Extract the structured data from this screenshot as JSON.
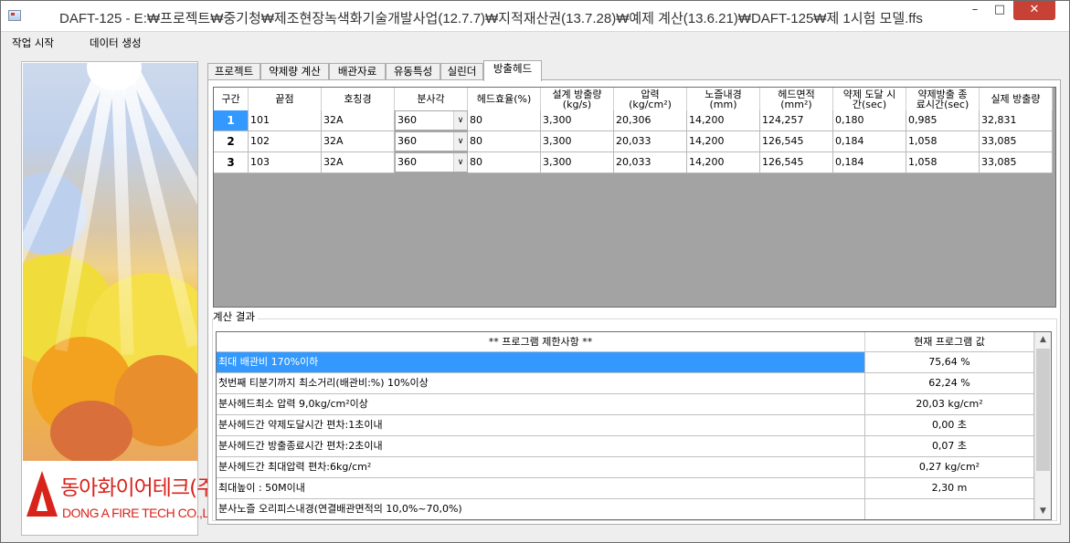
{
  "window": {
    "title": "DAFT-125 - E:₩프로젝트₩중기청₩제조현장녹색화기술개발사업(12.7.7)₩지적재산권(13.7.28)₩예제 계산(13.6.21)₩DAFT-125₩제 1시험 모델.ffs",
    "min": "–",
    "max": "□",
    "close": "✕"
  },
  "menu": {
    "start": "작업 시작",
    "generate": "데이터 생성"
  },
  "logo": {
    "kr": "동아화이어테크(주)",
    "en": "DONG A FIRE TECH CO.,LTD."
  },
  "tabs": [
    "프로젝트",
    "약제량 계산",
    "배관자료",
    "유동특성",
    "실린더",
    "방출헤드"
  ],
  "active_tab": 5,
  "grid": {
    "headers": [
      "구간",
      "끝점",
      "호칭경",
      "분사각",
      "헤드효율(%)",
      "설계 방출량\n(kg/s)",
      "압력\n(kg/cm²)",
      "노즐내경\n(mm)",
      "헤드면적\n(mm²)",
      "약제 도달 시\n간(sec)",
      "약제방출 종\n료시간(sec)",
      "실제 방출량"
    ],
    "rows": [
      [
        "1",
        "101",
        "32A",
        "360",
        "80",
        "3,300",
        "20,306",
        "14,200",
        "124,257",
        "0,180",
        "0,985",
        "32,831"
      ],
      [
        "2",
        "102",
        "32A",
        "360",
        "80",
        "3,300",
        "20,033",
        "14,200",
        "126,545",
        "0,184",
        "1,058",
        "33,085"
      ],
      [
        "3",
        "103",
        "32A",
        "360",
        "80",
        "3,300",
        "20,033",
        "14,200",
        "126,545",
        "0,184",
        "1,058",
        "33,085"
      ]
    ],
    "selected_row": 0
  },
  "result": {
    "label": "계산 결과",
    "headers": [
      "** 프로그램 제한사항 **",
      "현재 프로그램 값"
    ],
    "rows": [
      [
        "최대 배관비  170%이하",
        "75,64 %"
      ],
      [
        "첫번째 티분기까지 최소거리(배관비:%) 10%이상",
        "62,24 %"
      ],
      [
        "분사헤드최소 압력 9,0kg/cm²이상",
        "20,03 kg/cm²"
      ],
      [
        "분사헤드간 약제도달시간 편차:1초이내",
        "0,00 초"
      ],
      [
        "분사헤드간 방출종료시간 편차:2초이내",
        "0,07 초"
      ],
      [
        "분사헤드간 최대압력 편차:6kg/cm²",
        "0,27 kg/cm²"
      ],
      [
        "최대높이 :  50M이내",
        "2,30 m"
      ],
      [
        "분사노즐 오리피스내경(연결배관면적의 10,0%~70,0%)",
        ""
      ]
    ],
    "selected_row": 0
  },
  "icons": {
    "dropdown": "chevron-down-icon",
    "scroll_up": "arrow-up-icon",
    "scroll_down": "arrow-down-icon"
  },
  "colors": {
    "selection": "#3399ff",
    "close": "#c84135",
    "logo_red": "#d8231b",
    "grid_empty": "#a3a3a3"
  }
}
